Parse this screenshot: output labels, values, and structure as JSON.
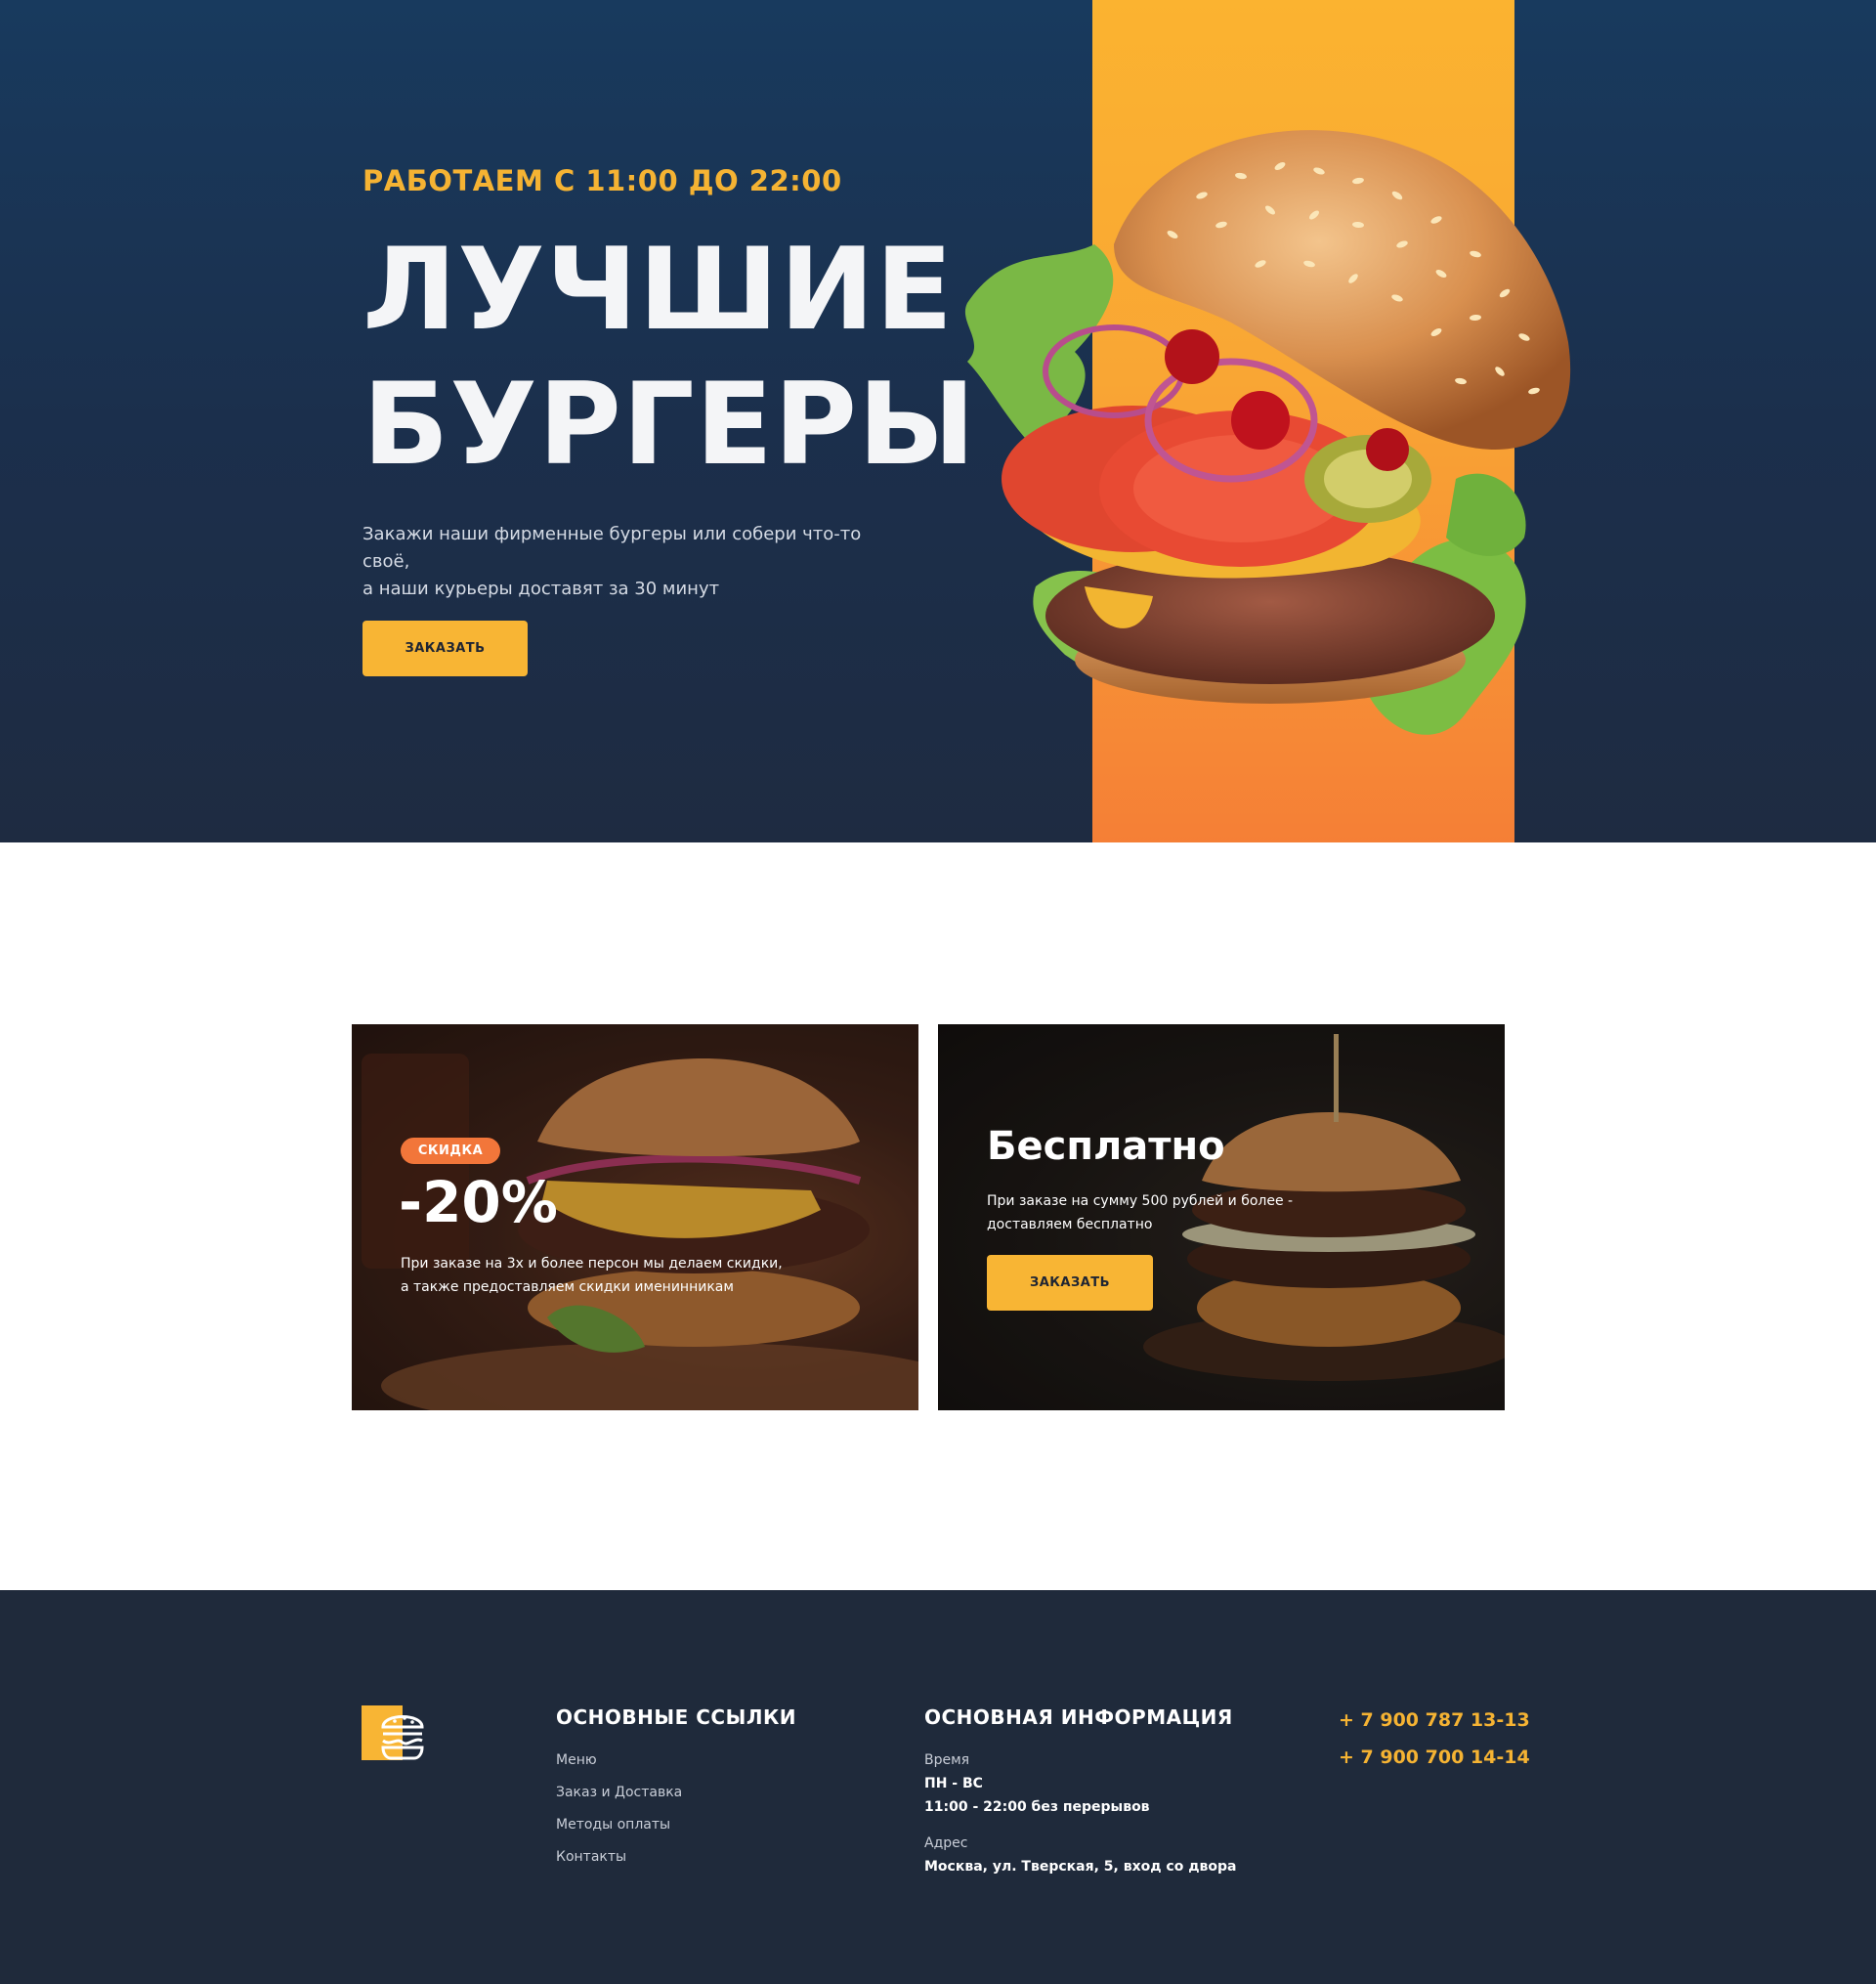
{
  "colors": {
    "hero_bg": "#1b2f4c",
    "accent_yellow": "#f8b534",
    "accent_orange": "#f57f36",
    "badge_orange": "#f2763a",
    "footer_bg": "#1f2a3b"
  },
  "hero": {
    "hours": "РАБОТАЕМ С 11:00 ДО 22:00",
    "title_line1": "ЛУЧШИЕ",
    "title_line2": "БУРГЕРЫ",
    "subtitle_line1": "Закажи наши фирменные бургеры или собери что-то своё,",
    "subtitle_line2": "а наши курьеры доставят за 30 минут",
    "button_label": "ЗАКАЗАТЬ"
  },
  "promo_discount": {
    "badge": "СКИДКА",
    "value": "-20%",
    "text": "При заказе на 3х и более персон мы делаем скидки, а также предоставляем скидки именинникам"
  },
  "promo_free": {
    "title": "Бесплатно",
    "text": "При заказе на сумму 500 рублей и более - доставляем бесплатно",
    "button_label": "ЗАКАЗАТЬ"
  },
  "footer": {
    "logo_icon": "burger-logo-icon",
    "links_heading": "ОСНОВНЫЕ ССЫЛКИ",
    "links": [
      "Меню",
      "Заказ и Доставка",
      "Методы оплаты",
      "Контакты"
    ],
    "info_heading": "ОСНОВНАЯ ИНФОРМАЦИЯ",
    "time_label": "Время",
    "time_days": "ПН - ВС",
    "time_hours": "11:00 - 22:00 без перерывов",
    "address_label": "Адрес",
    "address_value": "Москва, ул. Тверская, 5, вход со двора",
    "phones": [
      "+ 7 900 787 13-13",
      "+ 7 900 700 14-14"
    ]
  }
}
